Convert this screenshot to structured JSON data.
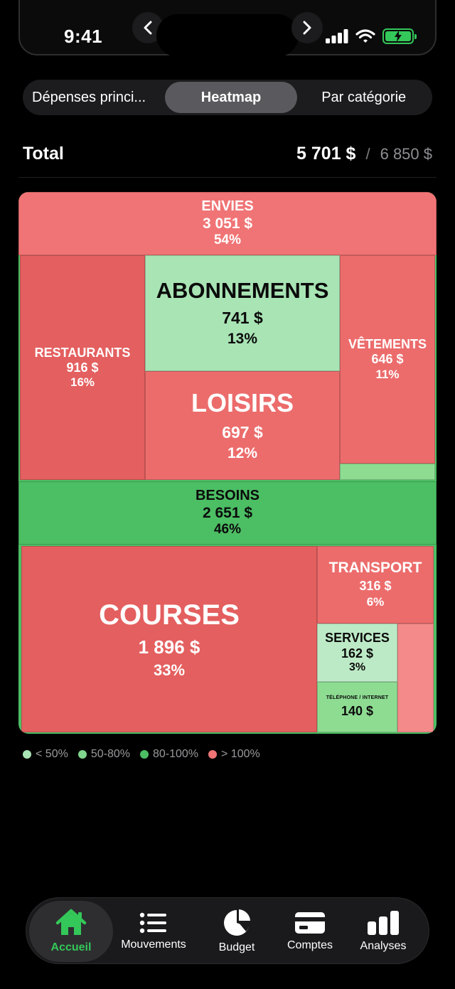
{
  "status_bar": {
    "time": "9:41",
    "back_icon": "chevron-left-icon",
    "forward_icon": "chevron-right-icon"
  },
  "segments": [
    {
      "label": "Dépenses princi...",
      "active": false
    },
    {
      "label": "Heatmap",
      "active": true
    },
    {
      "label": "Par catégorie",
      "active": false
    }
  ],
  "total": {
    "label": "Total",
    "spent": "5 701 $",
    "separator": "/",
    "budget": "6 850 $"
  },
  "treemap": {
    "envies": {
      "name": "ENVIES",
      "amount": "3 051 $",
      "percent": "54%"
    },
    "restaurants": {
      "name": "RESTAURANTS",
      "amount": "916 $",
      "percent": "16%"
    },
    "abonnements": {
      "name": "ABONNEMENTS",
      "amount": "741 $",
      "percent": "13%"
    },
    "loisirs": {
      "name": "LOISIRS",
      "amount": "697 $",
      "percent": "12%"
    },
    "vetements": {
      "name": "VÊTEMENTS",
      "amount": "646 $",
      "percent": "11%"
    },
    "besoins": {
      "name": "BESOINS",
      "amount": "2 651 $",
      "percent": "46%"
    },
    "courses": {
      "name": "COURSES",
      "amount": "1 896 $",
      "percent": "33%"
    },
    "transport": {
      "name": "TRANSPORT",
      "amount": "316 $",
      "percent": "6%"
    },
    "services": {
      "name": "SERVICES",
      "amount": "162 $",
      "percent": "3%"
    },
    "telephone": {
      "name": "TÉLÉPHONE / INTERNET",
      "amount": "140 $"
    }
  },
  "legend": [
    {
      "label": "< 50%",
      "color": "#a8e4b4"
    },
    {
      "label": "50-80%",
      "color": "#7fd68c"
    },
    {
      "label": "80-100%",
      "color": "#4cbe64"
    },
    {
      "label": "> 100%",
      "color": "#f07475"
    }
  ],
  "tabs": [
    {
      "label": "Accueil",
      "icon": "house-icon",
      "active": true
    },
    {
      "label": "Mouvements",
      "icon": "list-icon",
      "active": false
    },
    {
      "label": "Budget",
      "icon": "pie-chart-icon",
      "active": false
    },
    {
      "label": "Comptes",
      "icon": "credit-card-icon",
      "active": false
    },
    {
      "label": "Analyses",
      "icon": "bar-chart-icon",
      "active": false
    }
  ],
  "colors": {
    "accent": "#34c759",
    "over_budget": "#f07475",
    "on_budget": "#4cbe64"
  }
}
